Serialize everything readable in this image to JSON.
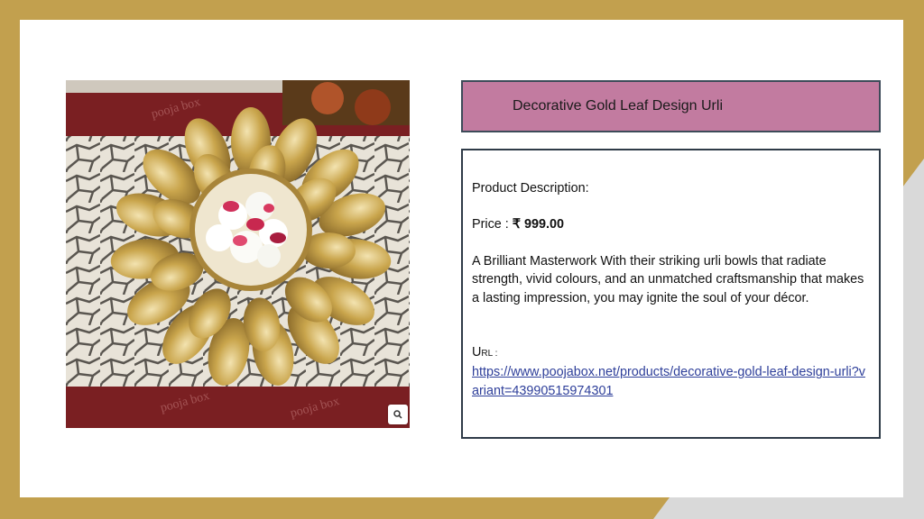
{
  "product": {
    "title": "Decorative Gold Leaf Design Urli",
    "description_heading": "Product Description:",
    "price_label": "Price : ",
    "currency_symbol": "₹",
    "price_value": "999.00",
    "description": "A Brilliant Masterwork With their striking urli bowls that radiate strength, vivid colours, and an unmatched craftsmanship that makes a lasting impression, you may ignite the soul of your décor.",
    "url_label_first": "U",
    "url_label_rest": "RL :",
    "url": "https://www.poojabox.net/products/decorative-gold-leaf-design-urli?variant=43990515974301"
  },
  "image": {
    "watermark": "pooja box",
    "zoom_icon": "magnifier-icon"
  },
  "colors": {
    "frame": "#c2a04e",
    "title_box": "#c27ba0",
    "box_border": "#2f3b48",
    "link": "#2e3f9a",
    "gold": "#c9a54c",
    "maroon": "#7a1f22"
  }
}
